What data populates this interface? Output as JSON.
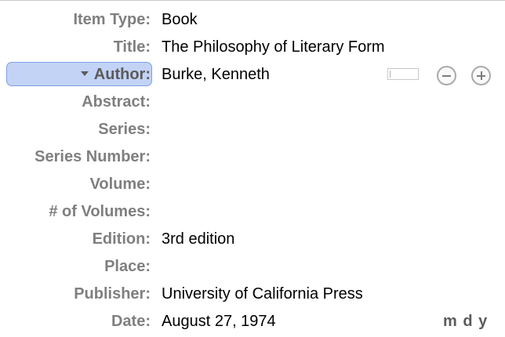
{
  "fields": [
    {
      "label": "Item Type:",
      "value": "Book"
    },
    {
      "label": "Title:",
      "value": "The Philosophy of Literary Form"
    },
    {
      "label": "Author:",
      "value": "Burke, Kenneth"
    },
    {
      "label": "Abstract:",
      "value": ""
    },
    {
      "label": "Series:",
      "value": ""
    },
    {
      "label": "Series Number:",
      "value": ""
    },
    {
      "label": "Volume:",
      "value": ""
    },
    {
      "label": "# of Volumes:",
      "value": ""
    },
    {
      "label": "Edition:",
      "value": "3rd edition"
    },
    {
      "label": "Place:",
      "value": ""
    },
    {
      "label": "Publisher:",
      "value": "University of California Press"
    },
    {
      "label": "Date:",
      "value": "August 27, 1974"
    }
  ],
  "date_format": "m d y",
  "icons": {
    "creator_type_menu": "triangle-down-icon",
    "remove_creator": "minus-circle-icon",
    "add_creator": "plus-circle-icon",
    "name_mode_switch": "switch-icon"
  },
  "colors": {
    "label": "#7f7f7f",
    "value": "#000000",
    "author_highlight": "#c3d3f5",
    "author_highlight_border": "#7aa0e6"
  }
}
